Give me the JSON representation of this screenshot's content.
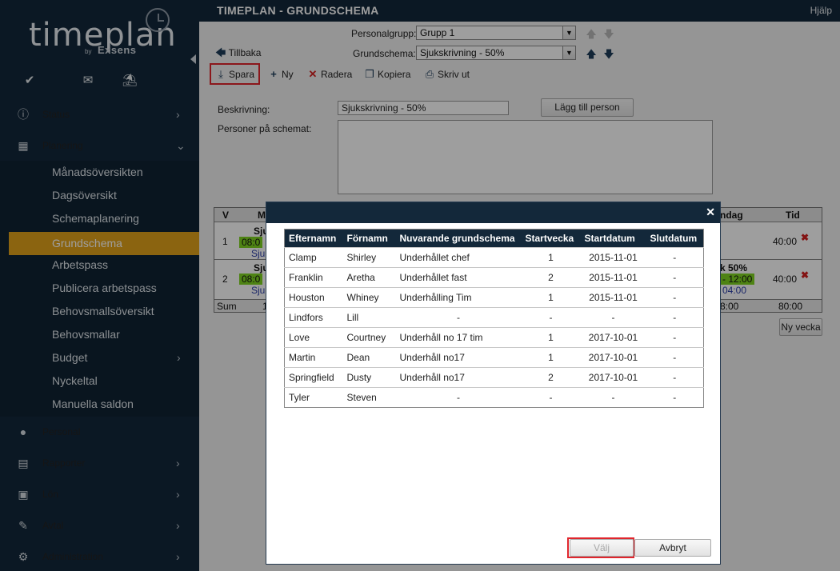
{
  "app": {
    "logo_text": "timeplan",
    "logo_by": "by",
    "logo_brand": "Exsens"
  },
  "header": {
    "title": "TIMEPLAN - GRUNDSCHEMA",
    "help": "Hjälp"
  },
  "sidebar": {
    "quick_icons": [
      "check-icon",
      "mail-icon",
      "beach-umbrella-icon"
    ],
    "sections": [
      {
        "label": "Status",
        "icon": "info-icon",
        "has_children": true
      },
      {
        "label": "Planering",
        "icon": "calendar-icon",
        "expanded": true
      },
      {
        "label": "Personal",
        "icon": "person-icon",
        "has_children": false
      },
      {
        "label": "Rapporter",
        "icon": "report-icon",
        "has_children": true
      },
      {
        "label": "Lön",
        "icon": "money-icon",
        "has_children": true
      },
      {
        "label": "Avtal",
        "icon": "wrench-icon",
        "has_children": true
      },
      {
        "label": "Administration",
        "icon": "gears-icon",
        "has_children": true
      }
    ],
    "planering_items": [
      {
        "label": "Månadsöversikten"
      },
      {
        "label": "Dagsöversikt"
      },
      {
        "label": "Schemaplanering"
      },
      {
        "label": "Grundschema",
        "active": true
      },
      {
        "label": "Arbetspass"
      },
      {
        "label": "Publicera arbetspass"
      },
      {
        "label": "Behovsmallsöversikt"
      },
      {
        "label": "Behovsmallar"
      },
      {
        "label": "Budget",
        "has_children": true
      },
      {
        "label": "Nyckeltal"
      },
      {
        "label": "Manuella saldon"
      }
    ]
  },
  "filters": {
    "personalgrupp_label": "Personalgrupp:",
    "personalgrupp_value": "Grupp 1",
    "grundschema_label": "Grundschema:",
    "grundschema_value": "Sjukskrivning - 50%",
    "back_label": "Tillbaka"
  },
  "toolbar": {
    "save": "Spara",
    "new": "Ny",
    "delete": "Radera",
    "copy": "Kopiera",
    "print": "Skriv ut"
  },
  "form": {
    "description_label": "Beskrivning:",
    "description_value": "Sjukskrivning - 50%",
    "add_person_button": "Lägg till person",
    "persons_label": "Personer på schemat:"
  },
  "schedule_bg": {
    "col_v": "V",
    "col_first": "M",
    "col_last_day": "ndag",
    "col_time": "Tid",
    "rows": [
      {
        "week": "1",
        "name_frag": "Sju",
        "time_frag": "08:0",
        "sub_frag": "Sjuk",
        "total": "40:00"
      },
      {
        "week": "2",
        "name_frag": "Sju",
        "time_frag": "08:0",
        "sub_frag": "Sjuk",
        "right_title": "k 50%",
        "right_time": "- 12:00",
        "right_sub": "04:00",
        "total": "40:00"
      }
    ],
    "sum_label": "Sum",
    "sum_first": "1",
    "sum_right": "8:00",
    "sum_total": "80:00",
    "new_week_button": "Ny vecka"
  },
  "modal": {
    "columns": [
      "Efternamn",
      "Förnamn",
      "Nuvarande grundschema",
      "Startvecka",
      "Startdatum",
      "Slutdatum"
    ],
    "rows": [
      {
        "last": "Clamp",
        "first": "Shirley",
        "schema": "Underhållet chef",
        "week": "1",
        "start": "2015-11-01",
        "end": "-"
      },
      {
        "last": "Franklin",
        "first": "Aretha",
        "schema": "Underhållet fast",
        "week": "2",
        "start": "2015-11-01",
        "end": "-"
      },
      {
        "last": "Houston",
        "first": "Whiney",
        "schema": "Underhålling Tim",
        "week": "1",
        "start": "2015-11-01",
        "end": "-"
      },
      {
        "last": "Lindfors",
        "first": "Lill",
        "schema": "-",
        "week": "-",
        "start": "-",
        "end": "-"
      },
      {
        "last": "Love",
        "first": "Courtney",
        "schema": "Underhåll no 17 tim",
        "week": "1",
        "start": "2017-10-01",
        "end": "-"
      },
      {
        "last": "Martin",
        "first": "Dean",
        "schema": "Underhåll no17",
        "week": "1",
        "start": "2017-10-01",
        "end": "-"
      },
      {
        "last": "Springfield",
        "first": "Dusty",
        "schema": "Underhåll no17",
        "week": "2",
        "start": "2017-10-01",
        "end": "-"
      },
      {
        "last": "Tyler",
        "first": "Steven",
        "schema": "-",
        "week": "-",
        "start": "-",
        "end": "-"
      }
    ],
    "select_button": "Välj",
    "cancel_button": "Avbryt"
  }
}
